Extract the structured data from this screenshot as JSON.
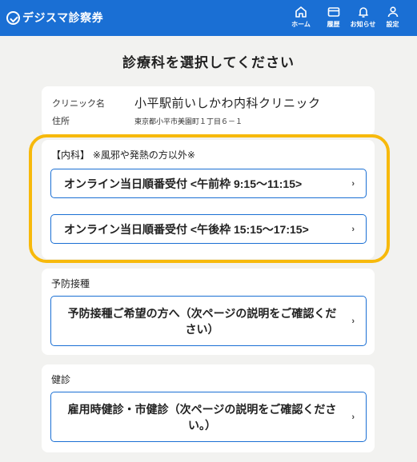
{
  "header": {
    "logo_text": "デジスマ診察券",
    "nav": [
      {
        "label": "ホーム",
        "icon": "home-icon"
      },
      {
        "label": "履歴",
        "icon": "history-card-icon"
      },
      {
        "label": "お知らせ",
        "icon": "bell-icon"
      },
      {
        "label": "設定",
        "icon": "user-icon"
      }
    ],
    "color": "#1a6fd4"
  },
  "page": {
    "title": "診療科を選択してください"
  },
  "clinic": {
    "name_label": "クリニック名",
    "name": "小平駅前いしかわ内科クリニック",
    "address_label": "住所",
    "address": "東京都小平市美園町１丁目６－１"
  },
  "departments": [
    {
      "title": "【内科】 ※風邪や発熱の方以外※",
      "buttons": [
        {
          "label": "オンライン当日順番受付 <午前枠 9:15〜11:15>",
          "chevron": "›"
        },
        {
          "label": "オンライン当日順番受付 <午後枠 15:15〜17:15>",
          "chevron": "›"
        }
      ]
    },
    {
      "title": "予防接種",
      "buttons": [
        {
          "label": "予防接種ご希望の方へ（次ページの説明をご確認ください）",
          "chevron": "›"
        }
      ]
    },
    {
      "title": "健診",
      "buttons": [
        {
          "label": "雇用時健診・市健診（次ページの説明をご確認ください。）",
          "chevron": "›"
        }
      ]
    }
  ],
  "highlight_color": "#f7b90b"
}
